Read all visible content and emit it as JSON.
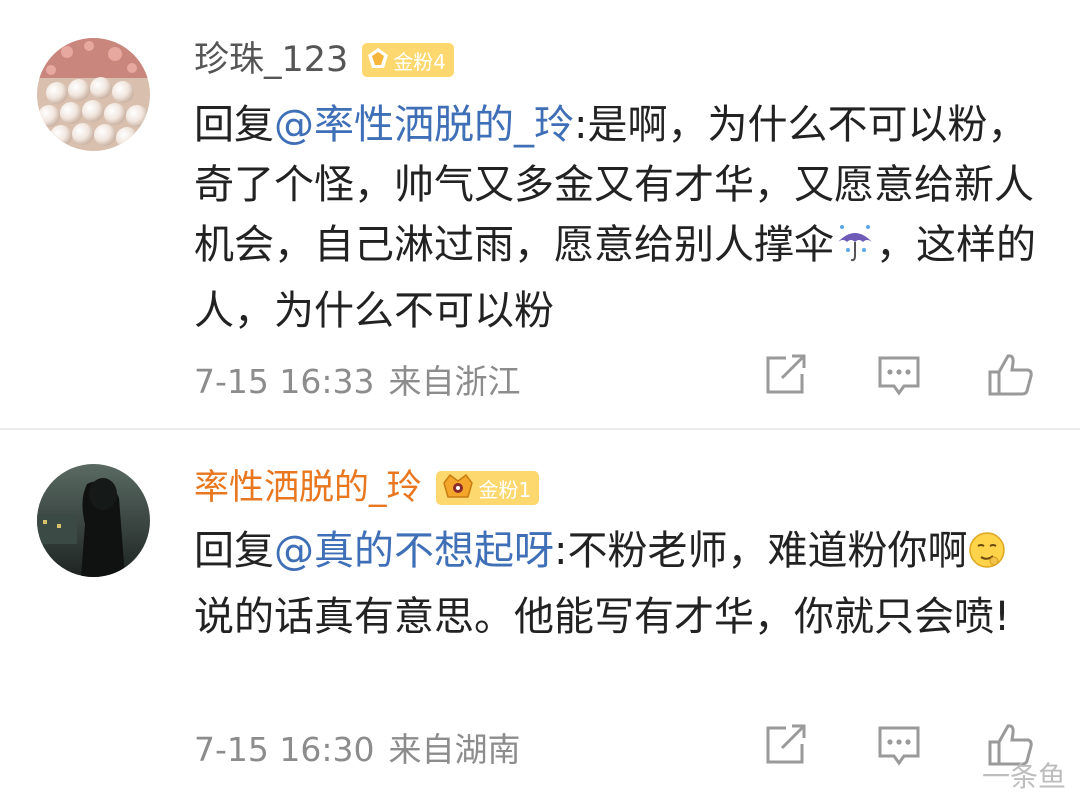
{
  "comments": [
    {
      "username": "珍珠_123",
      "badge": {
        "label": "金粉4",
        "color": "#fdd86f"
      },
      "reply_prefix": "回复",
      "mention": "@率性洒脱的_玲",
      "text_a": ":是啊，为什么不可以粉，奇了个怪，帅气又多金又有才华，又愿意给新人机会，自己淋过雨，愿意给别人撑伞",
      "emoji": "umbrella-rain",
      "text_b": "，这样的人，为什么不可以粉",
      "date": "7-15 16:33",
      "location": "来自浙江"
    },
    {
      "username": "率性洒脱的_玲",
      "badge": {
        "label": "金粉1",
        "color": "#fdd86f"
      },
      "reply_prefix": "回复",
      "mention": "@真的不想起呀",
      "text_a": ":不粉老师，难道粉你啊",
      "emoji": "smirk-face",
      "text_b": "说的话真有意思。他能写有才华，你就只会喷!",
      "date": "7-15 16:30",
      "location": "来自湖南"
    }
  ],
  "colors": {
    "username_gray": "#555555",
    "username_orange": "#e8771f",
    "mention_blue": "#3f6fb6",
    "meta_gray": "#8c8c8c"
  },
  "icons": [
    "repost-icon",
    "comment-icon",
    "like-icon"
  ],
  "watermark": {
    "text": "一条鱼"
  }
}
